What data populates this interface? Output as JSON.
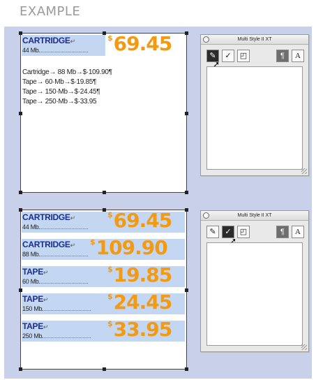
{
  "heading": "EXAMPLE",
  "palette": {
    "title": "Multi Style II XT",
    "tool_paragraph": "¶",
    "tool_char": "A"
  },
  "doc1": {
    "title": "CARTRIDGE",
    "title_mark": "↵",
    "sub": "44 Mb",
    "price_sup": "$",
    "price": "69.45",
    "rows": [
      "Cartridge→         88 Mb→$·109.90¶",
      "Tape→  60·Mb→$·19.85¶",
      "Tape→  150·Mb→$·24.45¶",
      "Tape→  250·Mb→$·33.95"
    ]
  },
  "doc2": {
    "items": [
      {
        "title": "CARTRIDGE",
        "mark": "↵",
        "sub": "44 Mb",
        "sup": "$",
        "price": "69.45"
      },
      {
        "title": "CARTRIDGE",
        "mark": "↵",
        "sub": "88 Mb",
        "sup": "$",
        "price": "109.90"
      },
      {
        "title": "TAPE",
        "mark": "↵",
        "sub": "60 Mb",
        "sup": "$",
        "price": "19.85"
      },
      {
        "title": "TAPE",
        "mark": "↵",
        "sub": "150 Mb",
        "sup": "$",
        "price": "24.45"
      },
      {
        "title": "TAPE",
        "mark": "↵",
        "sub": "250 Mb",
        "sup": "$",
        "price": "33.95"
      }
    ]
  }
}
